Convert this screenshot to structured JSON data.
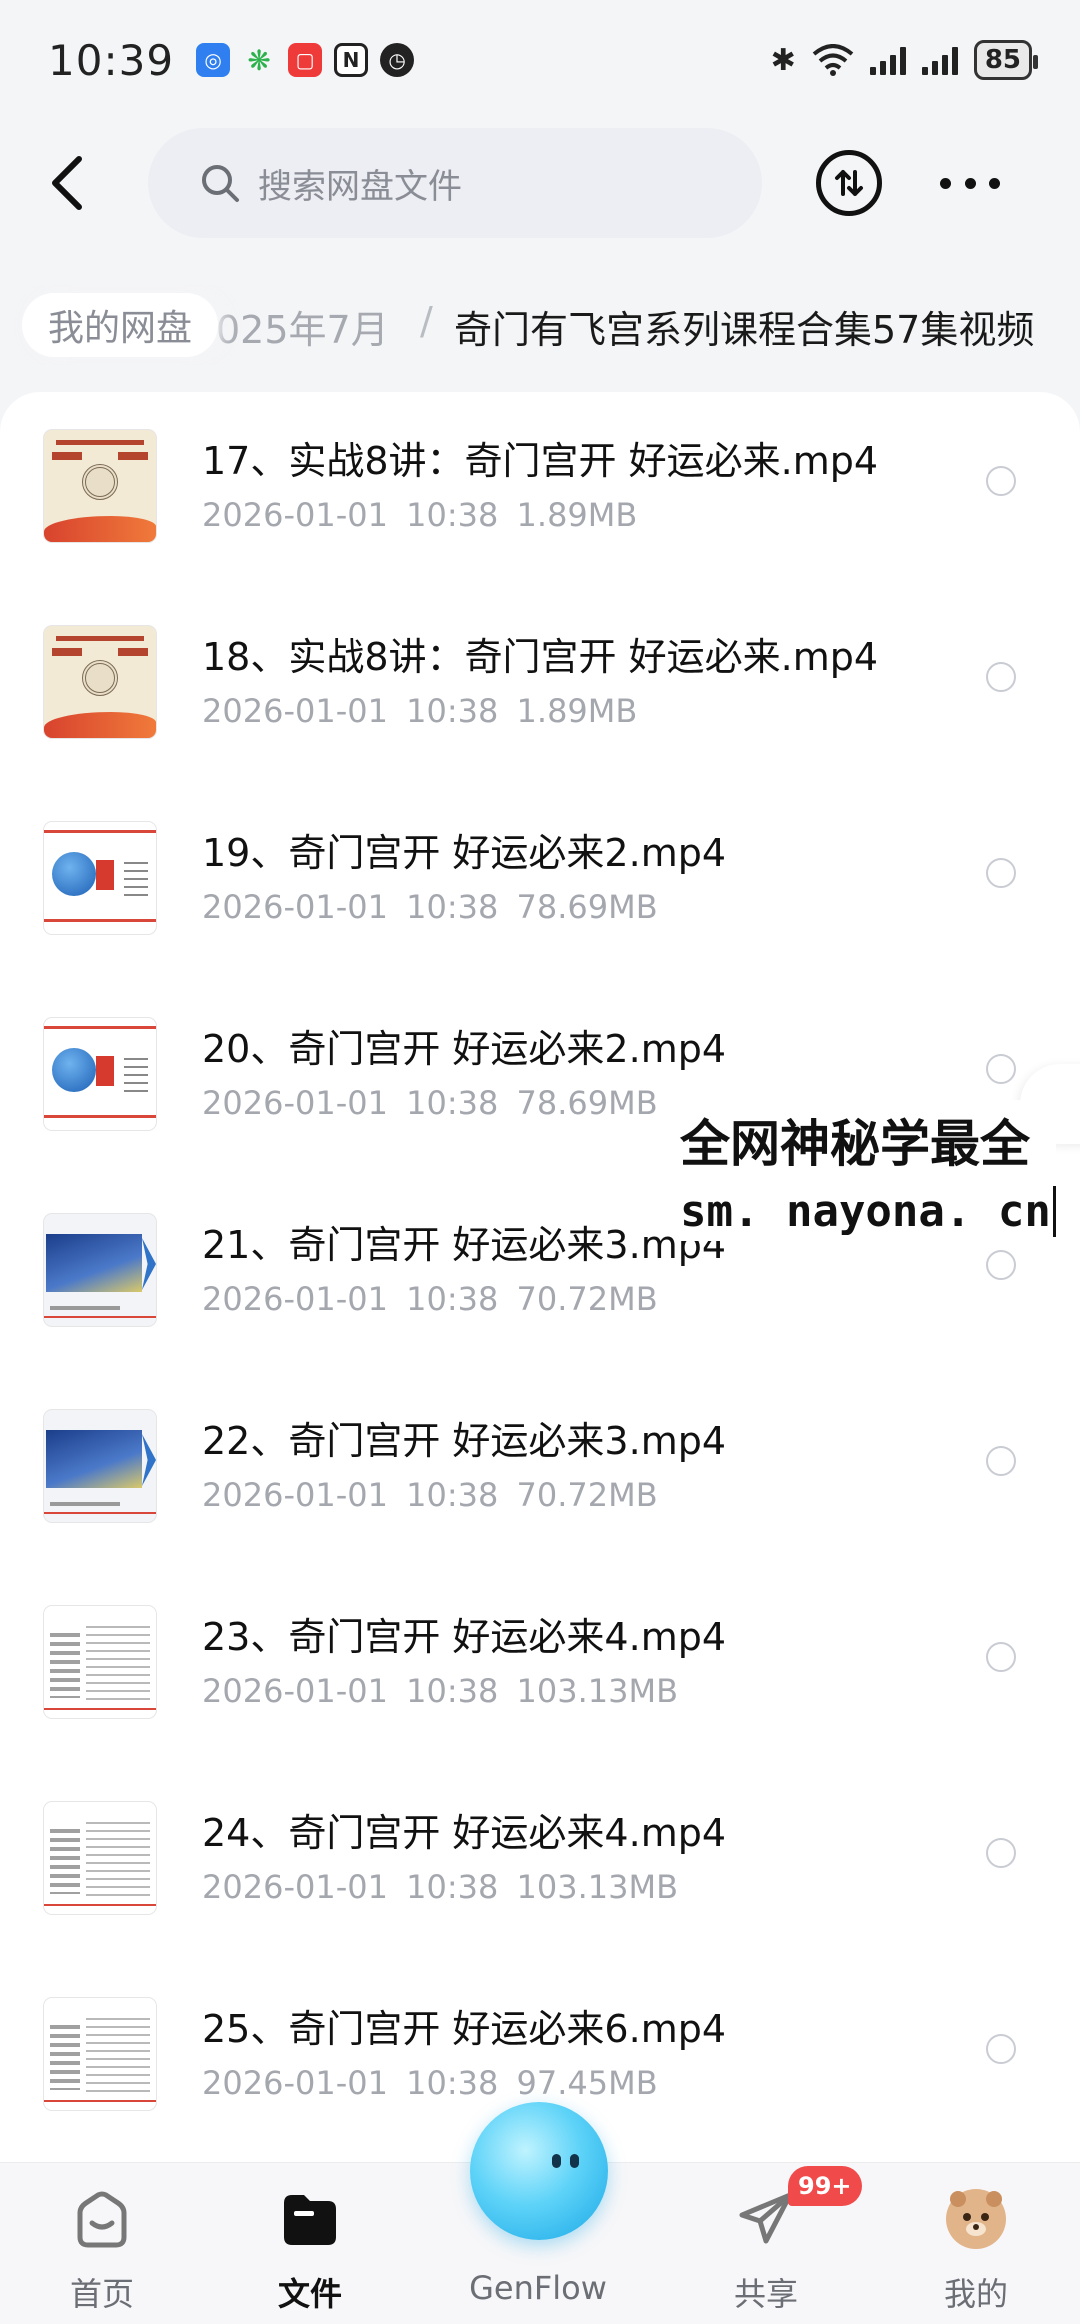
{
  "status_bar": {
    "time": "10:39",
    "battery": "85",
    "app_icons": [
      "qq-icon",
      "mobile-icon",
      "video-icon",
      "nfc-icon",
      "alarm-icon"
    ]
  },
  "header": {
    "search_placeholder": "搜索网盘文件"
  },
  "breadcrumb": {
    "root": "我的网盘",
    "parent": "025年7月",
    "separator": "/",
    "current": "奇门有飞宫系列课程合集57集视频"
  },
  "files": [
    {
      "name": "17、实战8讲：奇门宫开 好运必来.mp4",
      "date": "2026-01-01",
      "time": "10:38",
      "size": "1.89MB",
      "thumb": "cover"
    },
    {
      "name": "18、实战8讲：奇门宫开 好运必来.mp4",
      "date": "2026-01-01",
      "time": "10:38",
      "size": "1.89MB",
      "thumb": "cover"
    },
    {
      "name": "19、奇门宫开 好运必来2.mp4",
      "date": "2026-01-01",
      "time": "10:38",
      "size": "78.69MB",
      "thumb": "slide"
    },
    {
      "name": "20、奇门宫开 好运必来2.mp4",
      "date": "2026-01-01",
      "time": "10:38",
      "size": "78.69MB",
      "thumb": "slide"
    },
    {
      "name": "21、奇门宫开 好运必来3.mp4",
      "date": "2026-01-01",
      "time": "10:38",
      "size": "70.72MB",
      "thumb": "space"
    },
    {
      "name": "22、奇门宫开 好运必来3.mp4",
      "date": "2026-01-01",
      "time": "10:38",
      "size": "70.72MB",
      "thumb": "space"
    },
    {
      "name": "23、奇门宫开 好运必来4.mp4",
      "date": "2026-01-01",
      "time": "10:38",
      "size": "103.13MB",
      "thumb": "text"
    },
    {
      "name": "24、奇门宫开 好运必来4.mp4",
      "date": "2026-01-01",
      "time": "10:38",
      "size": "103.13MB",
      "thumb": "text"
    },
    {
      "name": "25、奇门宫开 好运必来6.mp4",
      "date": "2026-01-01",
      "time": "10:38",
      "size": "97.45MB",
      "thumb": "text"
    }
  ],
  "watermark": {
    "line1": "全网神秘学最全",
    "line2": "sm. nayona. cn"
  },
  "bottom_nav": {
    "home": "首页",
    "files": "文件",
    "genflow": "GenFlow",
    "share": "共享",
    "share_badge": "99+",
    "mine": "我的",
    "active": "files"
  },
  "colors": {
    "badge": "#f04a4a",
    "genflow_orb": "#19a7e6",
    "meta_text": "#a4a7ae"
  }
}
